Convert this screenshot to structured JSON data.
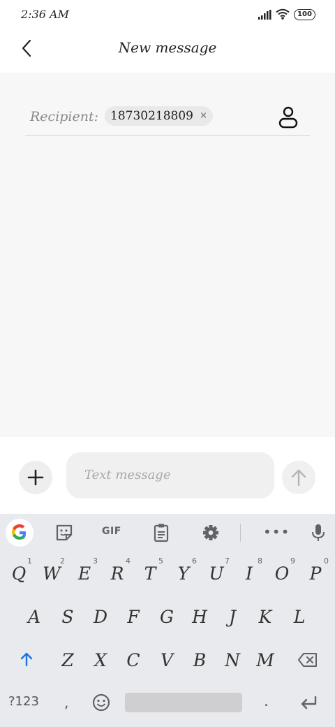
{
  "status_bar": {
    "time": "2:36 AM",
    "battery": "100"
  },
  "header": {
    "title": "New message"
  },
  "recipient": {
    "label": "Recipient:",
    "chip_number": "18730218809",
    "chip_remove": "×"
  },
  "composer": {
    "placeholder": "Text message"
  },
  "keyboard": {
    "toolbar": {
      "gif_label": "GIF",
      "more_label": "•••"
    },
    "row1": [
      {
        "key": "Q",
        "hint": "1"
      },
      {
        "key": "W",
        "hint": "2"
      },
      {
        "key": "E",
        "hint": "3"
      },
      {
        "key": "R",
        "hint": "4"
      },
      {
        "key": "T",
        "hint": "5"
      },
      {
        "key": "Y",
        "hint": "6"
      },
      {
        "key": "U",
        "hint": "7"
      },
      {
        "key": "I",
        "hint": "8"
      },
      {
        "key": "O",
        "hint": "9"
      },
      {
        "key": "P",
        "hint": "0"
      }
    ],
    "row2": [
      "A",
      "S",
      "D",
      "F",
      "G",
      "H",
      "J",
      "K",
      "L"
    ],
    "row3": [
      "Z",
      "X",
      "C",
      "V",
      "B",
      "N",
      "M"
    ],
    "row4": {
      "symbols_label": "?123",
      "comma": ",",
      "period": "."
    }
  },
  "icons": {
    "back": "back-arrow-icon",
    "contact": "contact-icon",
    "add": "plus-icon",
    "send": "send-arrow-icon",
    "google": "google-icon",
    "sticker": "sticker-icon",
    "clipboard": "clipboard-icon",
    "settings": "gear-icon",
    "mic": "microphone-icon",
    "shift": "shift-arrow-icon",
    "backspace": "backspace-icon",
    "emoji": "emoji-icon",
    "enter": "enter-icon",
    "signal": "signal-icon",
    "wifi": "wifi-icon",
    "battery": "battery-icon"
  },
  "colors": {
    "shift_accent": "#1a73e8",
    "keyboard_bg": "#e8eaed",
    "compose_bg": "#f7f7f7"
  }
}
